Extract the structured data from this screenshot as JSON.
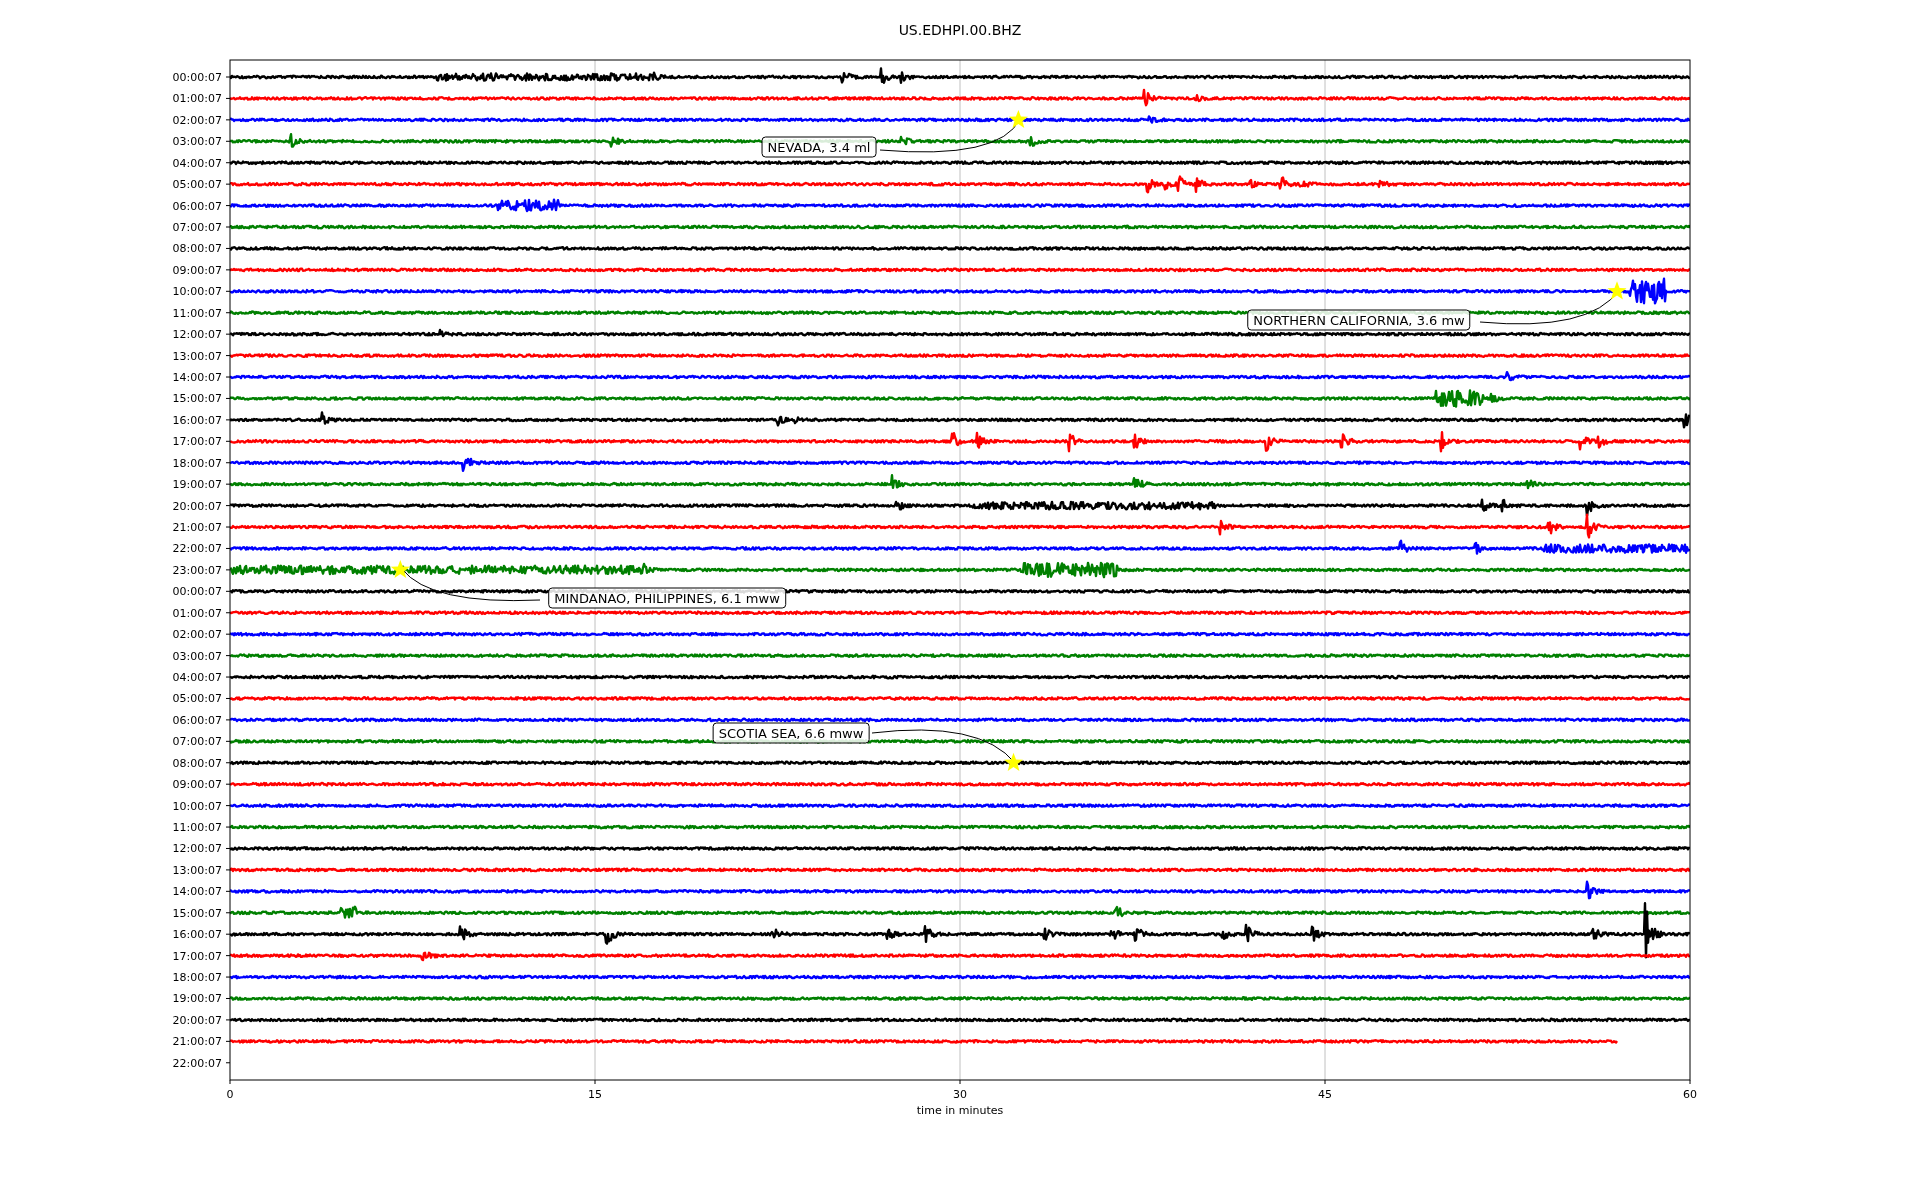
{
  "title": "US.EDHPI.00.BHZ",
  "plot": {
    "xlabel": "time in minutes",
    "xticks": [
      "0",
      "15",
      "30",
      "45",
      "60"
    ],
    "rows": [
      {
        "label": "00:00:07",
        "color": "#000000"
      },
      {
        "label": "01:00:07",
        "color": "#ff0000"
      },
      {
        "label": "02:00:07",
        "color": "#0000ff"
      },
      {
        "label": "03:00:07",
        "color": "#008000"
      },
      {
        "label": "04:00:07",
        "color": "#000000"
      },
      {
        "label": "05:00:07",
        "color": "#ff0000"
      },
      {
        "label": "06:00:07",
        "color": "#0000ff"
      },
      {
        "label": "07:00:07",
        "color": "#008000"
      },
      {
        "label": "08:00:07",
        "color": "#000000"
      },
      {
        "label": "09:00:07",
        "color": "#ff0000"
      },
      {
        "label": "10:00:07",
        "color": "#0000ff"
      },
      {
        "label": "11:00:07",
        "color": "#008000"
      },
      {
        "label": "12:00:07",
        "color": "#000000"
      },
      {
        "label": "13:00:07",
        "color": "#ff0000"
      },
      {
        "label": "14:00:07",
        "color": "#0000ff"
      },
      {
        "label": "15:00:07",
        "color": "#008000"
      },
      {
        "label": "16:00:07",
        "color": "#000000"
      },
      {
        "label": "17:00:07",
        "color": "#ff0000"
      },
      {
        "label": "18:00:07",
        "color": "#0000ff"
      },
      {
        "label": "19:00:07",
        "color": "#008000"
      },
      {
        "label": "20:00:07",
        "color": "#000000"
      },
      {
        "label": "21:00:07",
        "color": "#ff0000"
      },
      {
        "label": "22:00:07",
        "color": "#0000ff"
      },
      {
        "label": "23:00:07",
        "color": "#008000"
      },
      {
        "label": "00:00:07",
        "color": "#000000"
      },
      {
        "label": "01:00:07",
        "color": "#ff0000"
      },
      {
        "label": "02:00:07",
        "color": "#0000ff"
      },
      {
        "label": "03:00:07",
        "color": "#008000"
      },
      {
        "label": "04:00:07",
        "color": "#000000"
      },
      {
        "label": "05:00:07",
        "color": "#ff0000"
      },
      {
        "label": "06:00:07",
        "color": "#0000ff"
      },
      {
        "label": "07:00:07",
        "color": "#008000"
      },
      {
        "label": "08:00:07",
        "color": "#000000"
      },
      {
        "label": "09:00:07",
        "color": "#ff0000"
      },
      {
        "label": "10:00:07",
        "color": "#0000ff"
      },
      {
        "label": "11:00:07",
        "color": "#008000"
      },
      {
        "label": "12:00:07",
        "color": "#000000"
      },
      {
        "label": "13:00:07",
        "color": "#ff0000"
      },
      {
        "label": "14:00:07",
        "color": "#0000ff"
      },
      {
        "label": "15:00:07",
        "color": "#008000"
      },
      {
        "label": "16:00:07",
        "color": "#000000"
      },
      {
        "label": "17:00:07",
        "color": "#ff0000"
      },
      {
        "label": "18:00:07",
        "color": "#0000ff"
      },
      {
        "label": "19:00:07",
        "color": "#008000"
      },
      {
        "label": "20:00:07",
        "color": "#000000"
      },
      {
        "label": "21:00:07",
        "color": "#ff0000"
      },
      {
        "label": "22:00:07"
      }
    ],
    "events": [
      {
        "label": "NEVADA, 3.4 ml"
      },
      {
        "label": "NORTHERN CALIFORNIA, 3.6 mw"
      },
      {
        "label": "MINDANAO, PHILIPPINES, 6.1 mww"
      },
      {
        "label": "SCOTIA SEA, 6.6 mww"
      }
    ]
  }
}
